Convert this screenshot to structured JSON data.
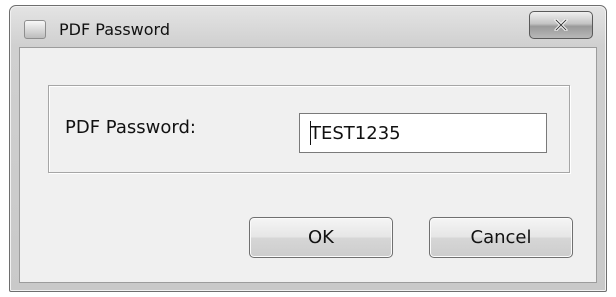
{
  "window": {
    "title": "PDF Password",
    "close_glyph": "X",
    "app_icon": "window-icon"
  },
  "form": {
    "password_label": "PDF Password:",
    "password_value": "TEST1235"
  },
  "buttons": {
    "ok_label": "OK",
    "cancel_label": "Cancel"
  },
  "colors": {
    "frame": "#c9c9c9",
    "client": "#f0f0f0",
    "input_bg": "#ffffff"
  }
}
